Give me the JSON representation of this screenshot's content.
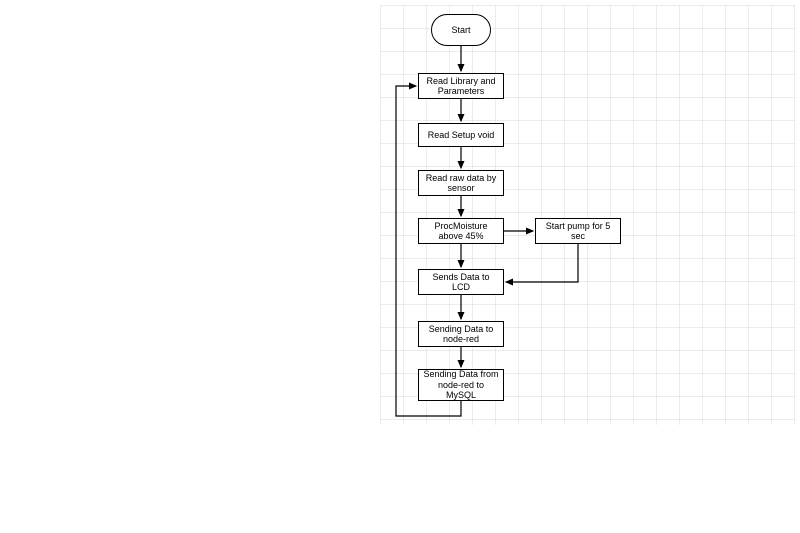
{
  "flow": {
    "start": "Start",
    "readLib": "Read Library and Parameters",
    "readSetup": "Read Setup void",
    "readRaw": "Read raw data by sensor",
    "procMoist": "ProcMoisture above 45%",
    "startPump": "Start pump for 5 sec",
    "sendsLCD": "Sends Data to LCD",
    "sendNodeRed": "Sending Data to node-red",
    "sendMySQL": "Sending Data from node-red to MySQL",
    "loopBack": "loop back to Read Library and Parameters"
  },
  "diagram": {
    "type": "flowchart",
    "threshold_percent": 45,
    "pump_duration_sec": 5
  }
}
